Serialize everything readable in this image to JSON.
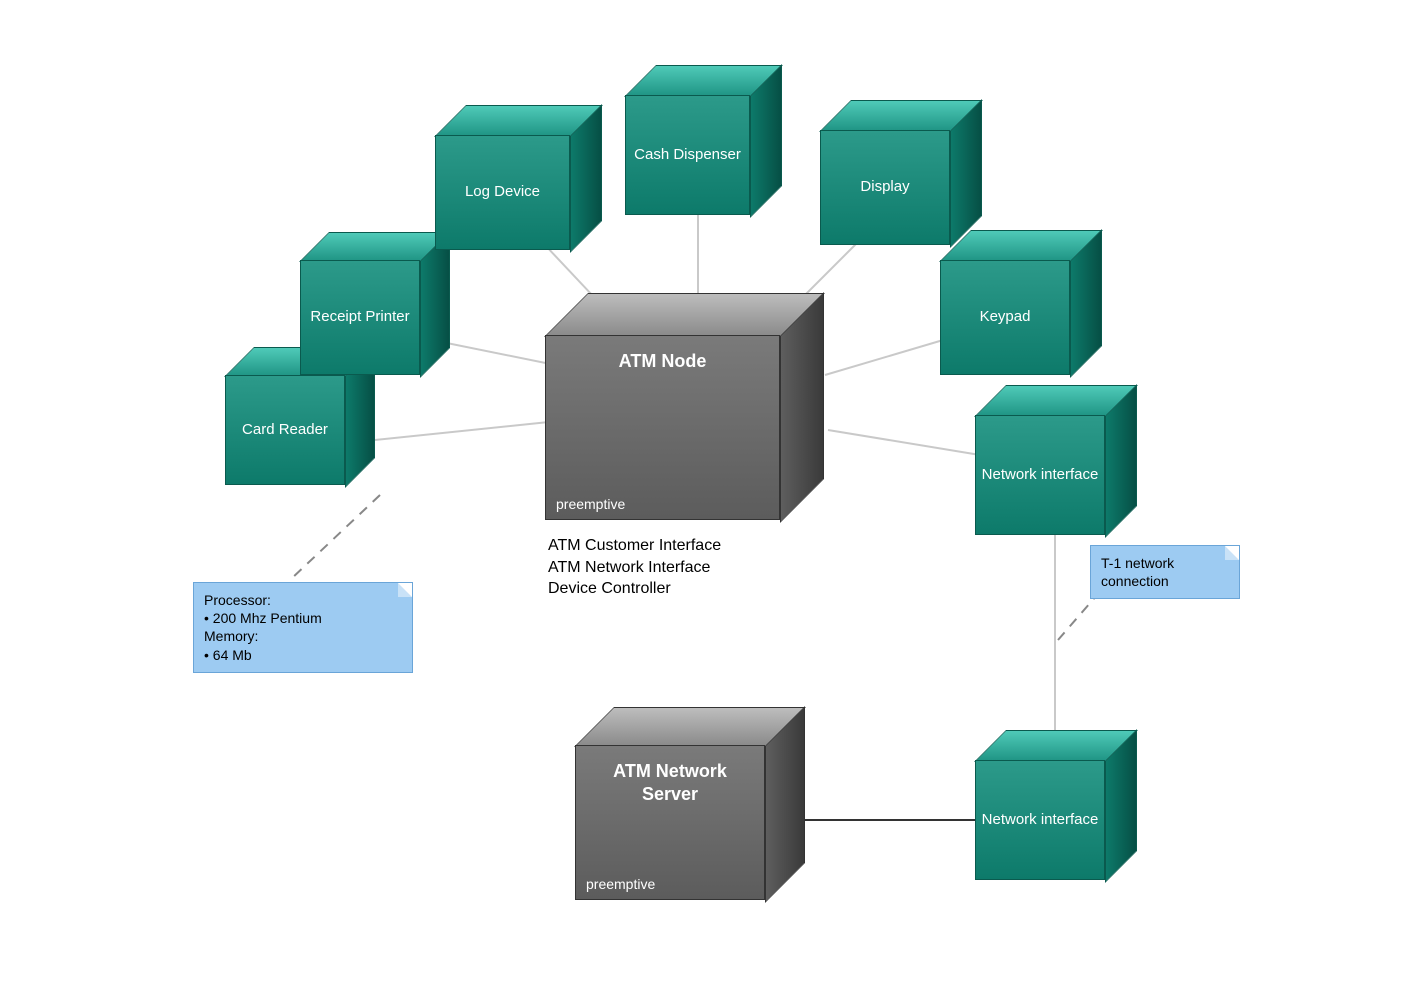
{
  "nodes": {
    "card_reader": "Card\nReader",
    "receipt_printer": "Receipt\nPrinter",
    "log_device": "Log Device",
    "cash_dispenser": "Cash\nDispenser",
    "display": "Display",
    "keypad": "Keypad",
    "network_interface_top": "Network\ninterface",
    "network_interface_bottom": "Network\ninterface"
  },
  "atm_node": {
    "title": "ATM Node",
    "tag": "preemptive"
  },
  "atm_server": {
    "title": "ATM Network\nServer",
    "tag": "preemptive"
  },
  "caption": "ATM Customer Interface\nATM Network Interface\nDevice Controller",
  "note_processor": "Processor:\n• 200 Mhz Pentium\nMemory:\n• 64 Mb",
  "note_t1": "T-1 network\nconnection"
}
